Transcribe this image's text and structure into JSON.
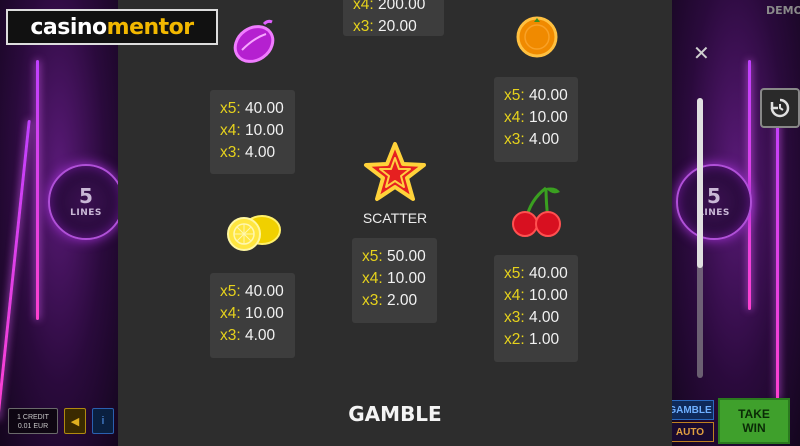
{
  "logo": {
    "part1": "casino",
    "part2": "mentor"
  },
  "badge_demo": "DEMO",
  "lines_left": {
    "number": "5",
    "label": "LINES"
  },
  "lines_right": {
    "number": "5",
    "label": "LINES"
  },
  "credit": {
    "line1": "1 CREDIT",
    "line2": "0.01 EUR"
  },
  "buttons": {
    "gamble": "GAMBLE",
    "auto": "AUTO",
    "take_win_l1": "TAKE",
    "take_win_l2": "WIN",
    "close": "✕"
  },
  "icons": {
    "plum": "plum-icon",
    "orange": "orange-icon",
    "lemon": "lemon-icon",
    "cherry": "cherry-icon",
    "star": "scatter-star-icon",
    "history": "history-icon"
  },
  "colors": {
    "panel": "#2d2d2d",
    "paybox": "#3d3d3d",
    "multiplier": "#e6d21c",
    "value": "#f2f2f2"
  },
  "paytable": {
    "top_center": {
      "rows": [
        {
          "mult": "x4:",
          "val": "200.00"
        },
        {
          "mult": "x3:",
          "val": "20.00"
        }
      ]
    },
    "plum": {
      "rows": [
        {
          "mult": "x5:",
          "val": "40.00"
        },
        {
          "mult": "x4:",
          "val": "10.00"
        },
        {
          "mult": "x3:",
          "val": "4.00"
        }
      ]
    },
    "orange": {
      "rows": [
        {
          "mult": "x5:",
          "val": "40.00"
        },
        {
          "mult": "x4:",
          "val": "10.00"
        },
        {
          "mult": "x3:",
          "val": "4.00"
        }
      ]
    },
    "scatter": {
      "label": "SCATTER",
      "rows": [
        {
          "mult": "x5:",
          "val": "50.00"
        },
        {
          "mult": "x4:",
          "val": "10.00"
        },
        {
          "mult": "x3:",
          "val": "2.00"
        }
      ]
    },
    "lemon": {
      "rows": [
        {
          "mult": "x5:",
          "val": "40.00"
        },
        {
          "mult": "x4:",
          "val": "10.00"
        },
        {
          "mult": "x3:",
          "val": "4.00"
        }
      ]
    },
    "cherry": {
      "rows": [
        {
          "mult": "x5:",
          "val": "40.00"
        },
        {
          "mult": "x4:",
          "val": "10.00"
        },
        {
          "mult": "x3:",
          "val": "4.00"
        },
        {
          "mult": "x2:",
          "val": "1.00"
        }
      ]
    }
  },
  "section_title": "GAMBLE"
}
